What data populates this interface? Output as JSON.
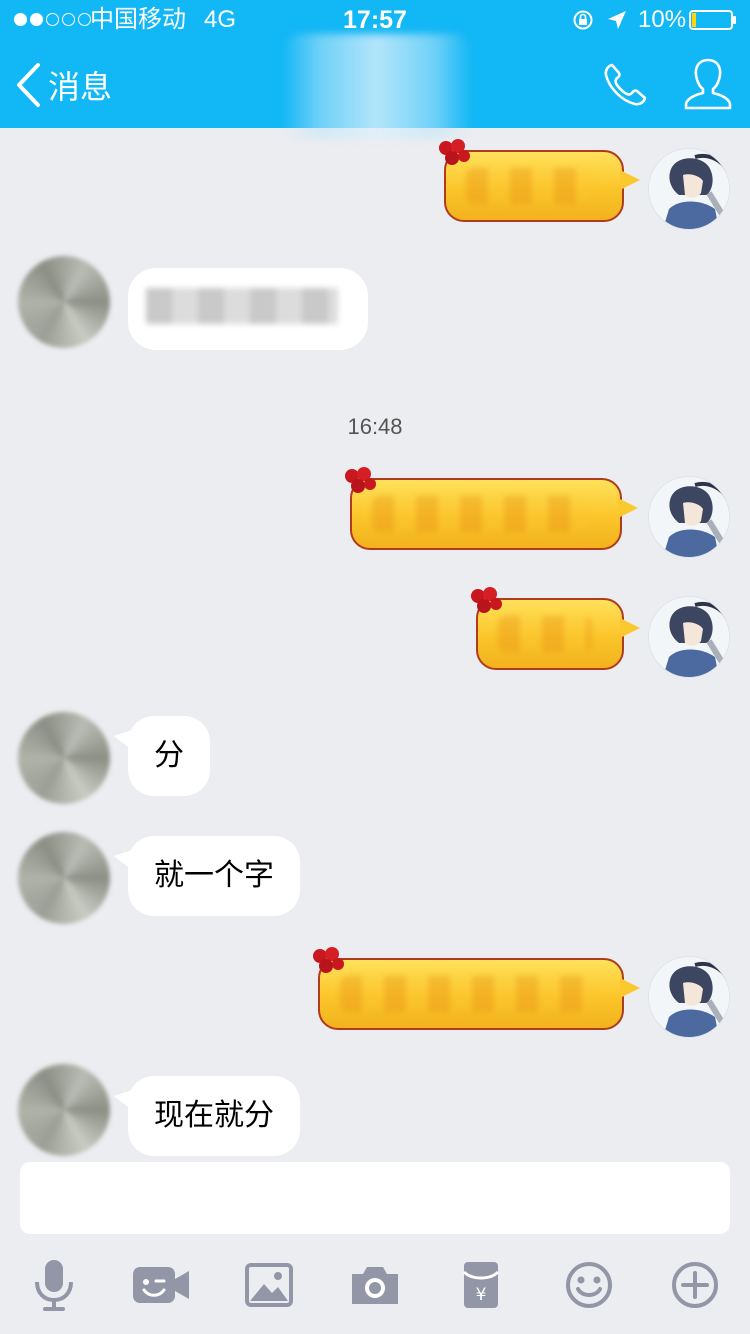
{
  "status_bar": {
    "carrier": "中国移动",
    "network": "4G",
    "time": "17:57",
    "battery_percent": "10%",
    "signal_bars_filled": 2,
    "signal_bars_total": 5
  },
  "nav_bar": {
    "back_label": "消息",
    "background_color": "#12B7F5"
  },
  "chat": {
    "timestamp": "16:48",
    "messages": [
      {
        "sender": "me",
        "style": "gold",
        "text": ""
      },
      {
        "sender": "other",
        "style": "white",
        "text": ""
      },
      {
        "sender": "me",
        "style": "gold",
        "text": ""
      },
      {
        "sender": "me",
        "style": "gold",
        "text": ""
      },
      {
        "sender": "other",
        "style": "white",
        "text": "分"
      },
      {
        "sender": "other",
        "style": "white",
        "text": "就一个字"
      },
      {
        "sender": "me",
        "style": "gold",
        "text": ""
      },
      {
        "sender": "other",
        "style": "white",
        "text": "现在就分"
      }
    ]
  },
  "input": {
    "placeholder": "",
    "value": ""
  },
  "toolbar": {
    "icons": [
      "microphone-icon",
      "video-emoji-icon",
      "image-icon",
      "camera-icon",
      "red-packet-icon",
      "emoji-icon",
      "plus-icon"
    ],
    "icon_color": "#9396A6"
  }
}
